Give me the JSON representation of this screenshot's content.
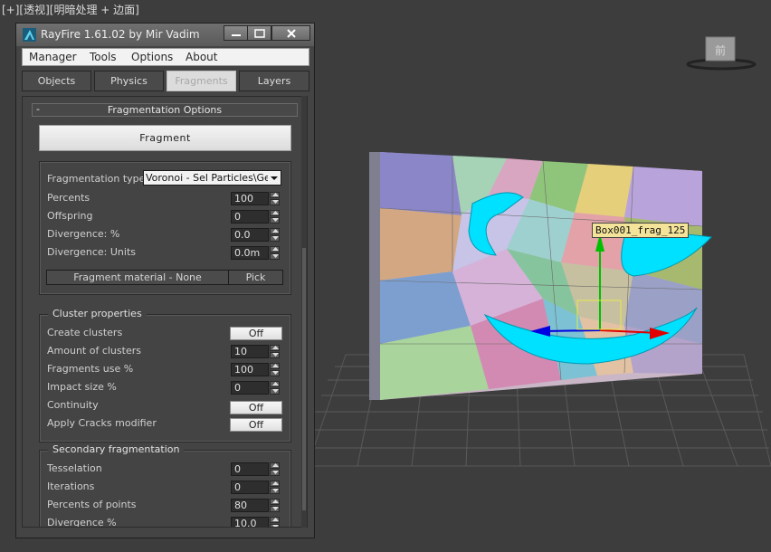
{
  "viewport": {
    "label": "[+][透视][明暗处理 + 边面]",
    "selection_tag": "Box001_frag_125",
    "viewcube_label": "前"
  },
  "colors": {
    "viewport_bg": "#3d3d3d",
    "selection_tag_bg": "#f4e49a",
    "fragment_highlight": "#00e0ff",
    "gizmo_x": "#e00000",
    "gizmo_y": "#00c000",
    "gizmo_z": "#0000e0"
  },
  "window": {
    "title": "RayFire 1.61.02  by Mir Vadim",
    "title_icon": "rayfire-app-icon",
    "minimize_icon": "minimize-icon",
    "maximize_icon": "maximize-icon",
    "close_icon": "close-icon"
  },
  "menu": [
    "Manager",
    "Tools",
    "Options",
    "About"
  ],
  "tabs": {
    "objects": "Objects",
    "physics": "Physics",
    "fragments": "Fragments",
    "layers": "Layers",
    "active": "Fragments"
  },
  "rollout": {
    "collapse_symbol": "-",
    "title": "Fragmentation Options",
    "fragment_button": "Fragment"
  },
  "fragmentation": {
    "type_label": "Fragmentation type",
    "type_value": "Voronoi - Sel Particles\\Geom",
    "percents_label": "Percents",
    "percents_value": "100",
    "offspring_label": "Offspring",
    "offspring_value": "0",
    "divergence_pct_label": "Divergence: %",
    "divergence_pct_value": "0.0",
    "divergence_units_label": "Divergence: Units",
    "divergence_units_value": "0.0m",
    "material_label": "Fragment material - None",
    "pick_label": "Pick"
  },
  "cluster": {
    "title": "Cluster properties",
    "create_label": "Create clusters",
    "create_value": "Off",
    "amount_label": "Amount of clusters",
    "amount_value": "10",
    "use_label": "Fragments use %",
    "use_value": "100",
    "impact_label": "Impact size %",
    "impact_value": "0",
    "continuity_label": "Continuity",
    "continuity_value": "Off",
    "cracks_label": "Apply Cracks modifier",
    "cracks_value": "Off"
  },
  "secondary": {
    "title": "Secondary fragmentation",
    "tesselation_label": "Tesselation",
    "tesselation_value": "0",
    "iterations_label": "Iterations",
    "iterations_value": "0",
    "points_label": "Percents of points",
    "points_value": "80",
    "divergence_label": "Divergence %",
    "divergence_value": "10.0"
  }
}
